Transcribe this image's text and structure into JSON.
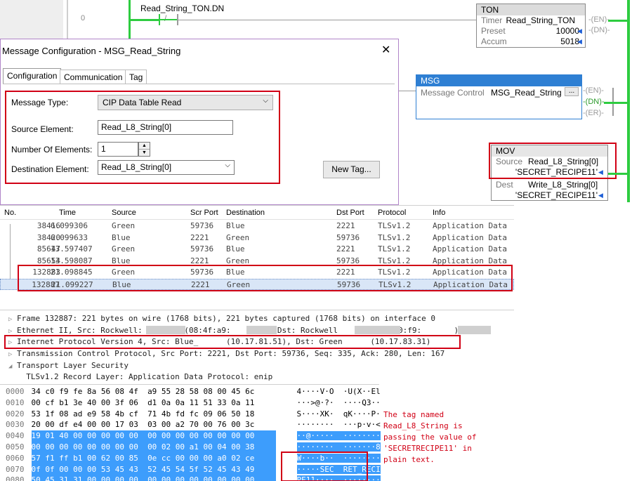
{
  "ladder": {
    "rung_number": "0",
    "contact_tag": "Read_String_TON.DN",
    "ton": {
      "title": "TON",
      "rows": [
        {
          "label": "Timer",
          "value": "Read_String_TON"
        },
        {
          "label": "Preset",
          "value": "10000"
        },
        {
          "label": "Accum",
          "value": "5018"
        }
      ],
      "coils": [
        "EN",
        "DN"
      ]
    },
    "msg": {
      "title": "MSG",
      "label": "Message Control",
      "value": "MSG_Read_String",
      "dots": "...",
      "coils": [
        "EN",
        "DN",
        "ER"
      ]
    },
    "mov": {
      "title": "MOV",
      "source_label": "Source",
      "source_tag": "Read_L8_String[0]",
      "source_value": "'SECRET_RECIPE11'",
      "dest_label": "Dest",
      "dest_tag": "Write_L8_String[0]",
      "dest_value": "'SECRET_RECIPE11'"
    }
  },
  "dialog": {
    "title": "Message Configuration - MSG_Read_String",
    "tabs": [
      "Configuration",
      "Communication",
      "Tag"
    ],
    "message_type_label": "Message Type:",
    "message_type_value": "CIP Data Table Read",
    "source_element_label": "Source Element:",
    "source_element_value": "Read_L8_String[0]",
    "num_elements_label": "Number Of Elements:",
    "num_elements_value": "1",
    "dest_element_label": "Destination Element:",
    "dest_element_value": "Read_L8_String[0]",
    "new_tag_button": "New Tag..."
  },
  "packet_list": {
    "columns": [
      "No.",
      "Time",
      "Source",
      "Scr Port",
      "Destination",
      "Dst Port",
      "Protocol",
      "Info"
    ],
    "rows": [
      [
        "38416",
        "6.099306",
        "Green",
        "59736",
        "Blue",
        "2221",
        "TLSv1.2",
        "Application Data"
      ],
      [
        "38420",
        "6.099633",
        "Blue",
        "2221",
        "Green",
        "59736",
        "TLSv1.2",
        "Application Data"
      ],
      [
        "85647",
        "13.597407",
        "Green",
        "59736",
        "Blue",
        "2221",
        "TLSv1.2",
        "Application Data"
      ],
      [
        "85654",
        "13.598087",
        "Blue",
        "2221",
        "Green",
        "59736",
        "TLSv1.2",
        "Application Data"
      ],
      [
        "132883",
        "21.098845",
        "Green",
        "59736",
        "Blue",
        "2221",
        "TLSv1.2",
        "Application Data"
      ],
      [
        "132887",
        "21.099227",
        "Blue",
        "2221",
        "Green",
        "59736",
        "TLSv1.2",
        "Application Data"
      ]
    ]
  },
  "details": {
    "rows": [
      "Frame 132887: 221 bytes on wire (1768 bits), 221 bytes captured (1768 bits) on interface 0",
      "Ethernet II, Src: Rockwell:       3 (08:4f:a9:       ), Dst: Rockwell        (34:c0:f9:       )",
      "Internet Protocol Version 4, Src: Blue_      (10.17.81.51), Dst: Green      (10.17.83.31)",
      "Transmission Control Protocol, Src Port: 2221, Dst Port: 59736, Seq: 335, Ack: 280, Len: 167",
      "Transport Layer Security",
      "  TLSv1.2 Record Layer: Application Data Protocol: enip"
    ]
  },
  "hex": {
    "offsets": [
      "0000",
      "0010",
      "0020",
      "0030",
      "0040",
      "0050",
      "0060",
      "0070",
      "0080"
    ],
    "bytes": [
      "34 c0 f9 fe 8a 56 08 4f  a9 55 28 58 08 00 45 6c",
      "00 cf b1 3e 40 00 3f 06  d1 0a 0a 11 51 33 0a 11",
      "53 1f 08 ad e9 58 4b cf  71 4b fd fc 09 06 50 18",
      "20 00 df e4 00 00 17 03  03 00 a2 70 00 76 00 3c",
      "19 01 40 00 00 00 00 00  00 00 00 00 00 00 00 00",
      "00 00 00 00 00 00 00 00  00 02 00 a1 00 04 00 38",
      "57 f1 ff b1 00 62 00 85  0e cc 00 00 00 a0 02 ce",
      "0f 0f 00 00 00 53 45 43  52 45 54 5f 52 45 43 49",
      "50 45 31 31 00 00 00 00  00 00 00 00 00 00 00 00"
    ],
    "ascii": [
      "4····V·O  ·U(X··El",
      "···>@·?·  ····Q3··",
      "S····XK·  qK····P·",
      "········  ···p·v·<",
      "··@·····  ········",
      "········  ·······8",
      "W····b··  ········",
      "·····SEC  RET_RECI",
      "PE11····  ········"
    ]
  },
  "annotation": "The tag named\nRead_L8_String is\npassing the value of\n'SECRETRECIPE11' in\nplain text.",
  "colors": {
    "highlight_red": "#d10015",
    "selection_blue": "#3d9dfc",
    "rung_green": "#2ecc40",
    "msg_blue": "#2e7fd3"
  }
}
